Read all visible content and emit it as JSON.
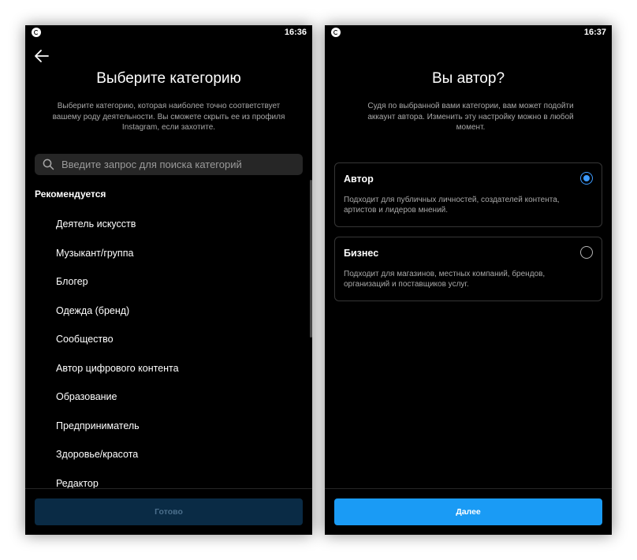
{
  "left_screen": {
    "status_time": "16:36",
    "title": "Выберите категорию",
    "description": "Выберите категорию, которая наиболее точно соответствует вашему роду деятельности. Вы сможете скрыть ее из профиля Instagram, если захотите.",
    "search_placeholder": "Введите запрос для поиска категорий",
    "section_heading": "Рекомендуется",
    "categories": [
      "Деятель искусств",
      "Музыкант/группа",
      "Блогер",
      "Одежда (бренд)",
      "Сообщество",
      "Автор цифрового контента",
      "Образование",
      "Предприниматель",
      "Здоровье/красота",
      "Редактор"
    ],
    "done_button": "Готово",
    "icons": {
      "back": "back-arrow-icon",
      "search": "search-icon",
      "status": "notification-icon"
    }
  },
  "right_screen": {
    "status_time": "16:37",
    "title": "Вы автор?",
    "description": "Судя по выбранной вами категории, вам может подойти аккаунт автора. Изменить эту настройку можно в любой момент.",
    "options": [
      {
        "title": "Автор",
        "description": "Подходит для публичных личностей, создателей контента, артистов и лидеров мнений.",
        "selected": true
      },
      {
        "title": "Бизнес",
        "description": "Подходит для магазинов, местных компаний, брендов, организаций и поставщиков услуг.",
        "selected": false
      }
    ],
    "next_button": "Далее"
  },
  "colors": {
    "background": "#000000",
    "accent": "#1a9bf5",
    "radio_selected": "#3d9bff",
    "button_disabled": "#0a2b45",
    "secondary_text": "#a8a8a8"
  }
}
